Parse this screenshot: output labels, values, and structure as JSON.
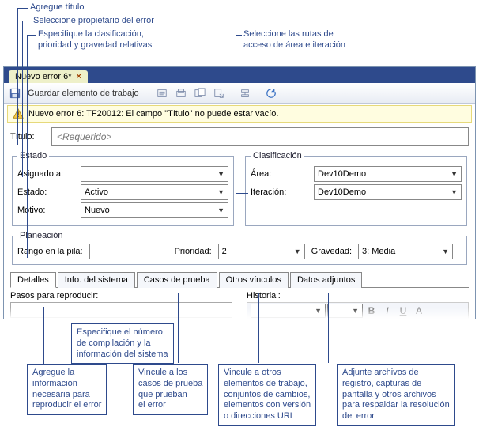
{
  "callouts": {
    "add_title": "Agregue título",
    "select_owner": "Seleccione propietario del error",
    "specify_class": "Especifique la clasificación,\nprioridad y gravedad relativas",
    "area_paths": "Seleccione las rutas de\nacceso de área e iteración",
    "sysinfo": "Especifique el número\nde compilación y la\ninformación del sistema",
    "add_repro": "Agregue la\ninformación\nnecesaria para\nreproducir el error",
    "link_tests": "Vincule a los\ncasos de prueba\nque prueban\nel error",
    "link_other": "Vincule a otros\nelementos de trabajo,\nconjuntos de cambios,\nelementos con versión\no direcciones URL",
    "attach": "Adjunte archivos de\nregistro, capturas de\npantalla y otros archivos\npara respaldar la resolución\ndel error"
  },
  "tab": {
    "title": "Nuevo error 6*"
  },
  "toolbar": {
    "save_label": "Guardar elemento de trabajo"
  },
  "error_bar": {
    "text": "Nuevo error 6: TF20012: El campo \"Título\" no puede estar vacío."
  },
  "title": {
    "label": "Título:",
    "placeholder": "<Requerido>"
  },
  "state": {
    "legend": "Estado",
    "assigned_label": "Asignado a:",
    "assigned_value": "",
    "state_label": "Estado:",
    "state_value": "Activo",
    "reason_label": "Motivo:",
    "reason_value": "Nuevo"
  },
  "classification": {
    "legend": "Clasificación",
    "area_label": "Área:",
    "area_value": "Dev10Demo",
    "iter_label": "Iteración:",
    "iter_value": "Dev10Demo"
  },
  "planning": {
    "legend": "Planeación",
    "stack_label": "Rango en la pila:",
    "stack_value": "",
    "prio_label": "Prioridad:",
    "prio_value": "2",
    "sev_label": "Gravedad:",
    "sev_value": "3: Media"
  },
  "tabs": {
    "details": "Detalles",
    "sysinfo": "Info. del sistema",
    "tests": "Casos de prueba",
    "links": "Otros vínculos",
    "attach": "Datos adjuntos"
  },
  "sub": {
    "repro_label": "Pasos para reproducir:",
    "history_label": "Historial:"
  }
}
